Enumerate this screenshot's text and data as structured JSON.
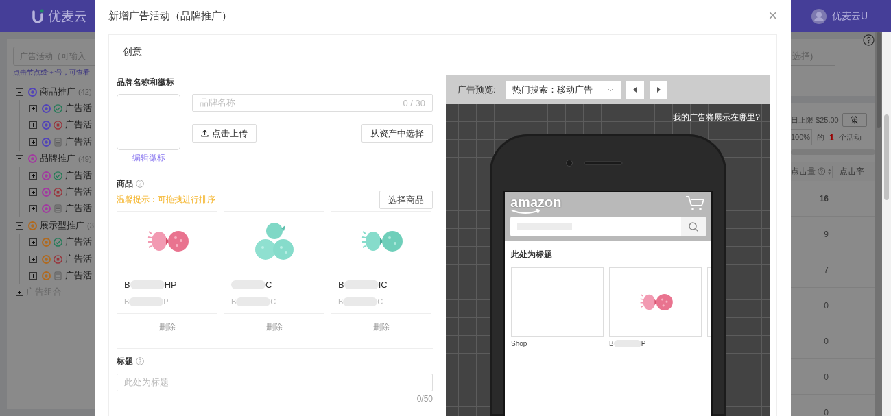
{
  "app": {
    "logo": "优麦云",
    "user": "优麦云U"
  },
  "sidebar": {
    "search_placeholder": "广告活动（可输入",
    "hint": "点击节点或\"+\"号，可查看",
    "tree": [
      {
        "label": "商品推广",
        "count": "(42)",
        "color": "#5244b8",
        "expanded": true,
        "disabled": false,
        "children": [
          {
            "kind": "enabled",
            "label": "广告活"
          },
          {
            "kind": "paused",
            "label": "广告活"
          },
          {
            "kind": "archived",
            "label": "广告活"
          }
        ]
      },
      {
        "label": "品牌推广",
        "count": "(49)",
        "color": "#a23aa0",
        "expanded": true,
        "disabled": false,
        "children": [
          {
            "kind": "enabled",
            "label": "广告活"
          },
          {
            "kind": "paused",
            "label": "广告活"
          },
          {
            "kind": "archived",
            "label": "广告活"
          }
        ]
      },
      {
        "label": "展示型推广",
        "count": "(3",
        "color": "#b06a20",
        "expanded": true,
        "disabled": false,
        "children": [
          {
            "kind": "enabled",
            "label": "广告活"
          },
          {
            "kind": "paused",
            "label": "广告活"
          },
          {
            "kind": "archived",
            "label": "广告活"
          }
        ]
      },
      {
        "label": "广告组合",
        "expanded": false,
        "disabled": true
      }
    ]
  },
  "background_panel": {
    "filter_field": "选择)",
    "budget": "日上限 $25.00",
    "strategy_button": "策",
    "percent_field": "100%",
    "of": "的",
    "count": "1",
    "unit": "个活动",
    "columns": [
      "点击量",
      "点击率"
    ],
    "clicks": [
      "16",
      "9",
      "7",
      "0",
      "0",
      "0",
      "0"
    ]
  },
  "modal": {
    "title": "新增广告活动（品牌推广）",
    "close": "×",
    "section": "创意",
    "brand": {
      "heading": "品牌名称和徽标",
      "edit_logo": "编辑徽标",
      "name_placeholder": "品牌名称",
      "name_counter": "0 / 30",
      "upload": "点击上传",
      "from_assets": "从资产中选择"
    },
    "products": {
      "heading": "商品",
      "tip": "温馨提示：可拖拽进行排序",
      "select": "选择商品",
      "items": [
        {
          "code_start": "B",
          "code_end": "HP",
          "sub_start": "B",
          "sub_end": "P",
          "redacted": true,
          "action": "删除"
        },
        {
          "code_end": "C",
          "sub_start": "B",
          "sub_end": "C",
          "redacted": true,
          "action": "删除"
        },
        {
          "code_start": "B",
          "code_end": "IC",
          "sub_start": "B",
          "sub_end": "C",
          "redacted": true,
          "action": "删除"
        }
      ]
    },
    "headline": {
      "heading": "标题",
      "placeholder": "此处为标题",
      "counter": "0/50"
    }
  },
  "preview": {
    "label": "广告预览:",
    "placement": "热门搜索：移动广告",
    "where": "我的广告将展示在哪里?",
    "store_logo": "amazon",
    "ad_title": "此处为标题",
    "tiles": [
      {
        "kind": "blank",
        "label": "Shop"
      },
      {
        "kind": "product",
        "label_start": "B",
        "label_end": "P",
        "redacted": true
      }
    ]
  }
}
